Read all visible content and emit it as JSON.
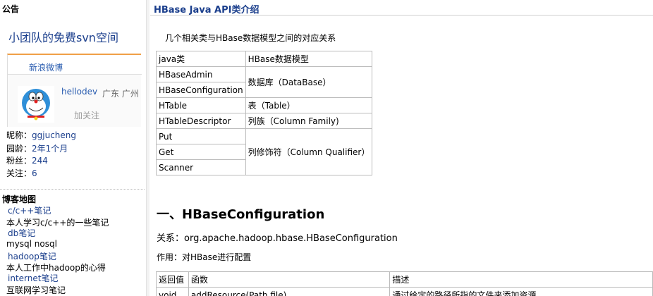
{
  "sidebar": {
    "announcement_heading": "公告",
    "svn_link": "小团队的免费svn空间",
    "weibo": {
      "tab_label": "新浪微博",
      "username": "hellodev",
      "location": "广东 广州",
      "follow_label": "加关注"
    },
    "stats": {
      "nickname_label": "昵称：",
      "nickname": "ggjucheng",
      "age_label": "园龄：",
      "age": "2年1个月",
      "fans_label": "粉丝：",
      "fans": "244",
      "following_label": "关注：",
      "following": "6"
    },
    "blogmap_heading": "博客地图",
    "nav": [
      {
        "text": "c/c++笔记",
        "link": true
      },
      {
        "text": "本人学习c/c++的一些笔记",
        "link": false
      },
      {
        "text": "db笔记",
        "link": true
      },
      {
        "text": "mysql nosql",
        "link": false
      },
      {
        "text": "hadoop笔记",
        "link": true
      },
      {
        "text": "本人工作中hadoop的心得",
        "link": false
      },
      {
        "text": "internet笔记",
        "link": true
      },
      {
        "text": "互联网学习笔记",
        "link": false
      }
    ]
  },
  "main": {
    "post_title": "HBase Java API类介绍",
    "intro": "几个相关类与HBase数据模型之间的对应关系",
    "mapping_table": {
      "header": [
        "java类",
        "HBase数据模型"
      ],
      "database_group": [
        "HBaseAdmin",
        "HBaseConfiguration"
      ],
      "database_model": "数据库（DataBase）",
      "table_row": [
        "HTable",
        "表（Table）"
      ],
      "family_row": [
        "HTableDescriptor",
        "列族（Column Family)"
      ],
      "qualifier_group": [
        "Put",
        "Get",
        "Scanner"
      ],
      "qualifier_model": "列修饰符（Column Qualifier）"
    },
    "section_heading": "一、HBaseConfiguration",
    "relation_line": "关系：org.apache.hadoop.hbase.HBaseConfiguration",
    "usage_line": "作用：对HBase进行配置",
    "api_table": {
      "header": [
        "返回值",
        "函数",
        "描述"
      ],
      "row1": [
        "void",
        "addResource(Path file)",
        "通过给定的路径所指的文件来添加资源"
      ]
    }
  },
  "colors": {
    "link": "#1a3e8c",
    "weibo_accent": "#f0a048",
    "border": "#bbbbbb"
  }
}
